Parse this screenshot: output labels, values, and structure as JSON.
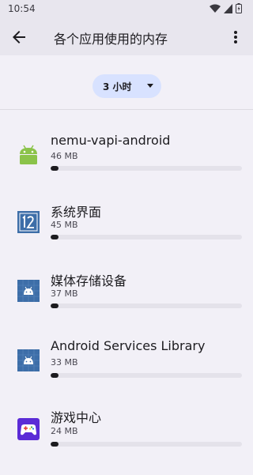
{
  "status_bar": {
    "time": "10:54"
  },
  "app_bar": {
    "title": "各个应用使用的内存"
  },
  "filter": {
    "selected": "3 小时"
  },
  "apps": [
    {
      "name": "nemu-vapi-android",
      "size": "46 MB",
      "usage_fraction": 0.04,
      "icon": "android-robot-icon"
    },
    {
      "name": "系统界面",
      "size": "45 MB",
      "usage_fraction": 0.04,
      "icon": "system-ui-icon"
    },
    {
      "name": "媒体存储设备",
      "size": "37 MB",
      "usage_fraction": 0.04,
      "icon": "android-app-icon"
    },
    {
      "name": "Android Services Library",
      "size": "33 MB",
      "usage_fraction": 0.04,
      "icon": "android-app-icon"
    },
    {
      "name": "游戏中心",
      "size": "24 MB",
      "usage_fraction": 0.04,
      "icon": "game-center-icon"
    }
  ],
  "colors": {
    "accent_chip": "#d8e2ff",
    "background": "#f2f0f7",
    "bar_fill": "#1c1b1f"
  }
}
